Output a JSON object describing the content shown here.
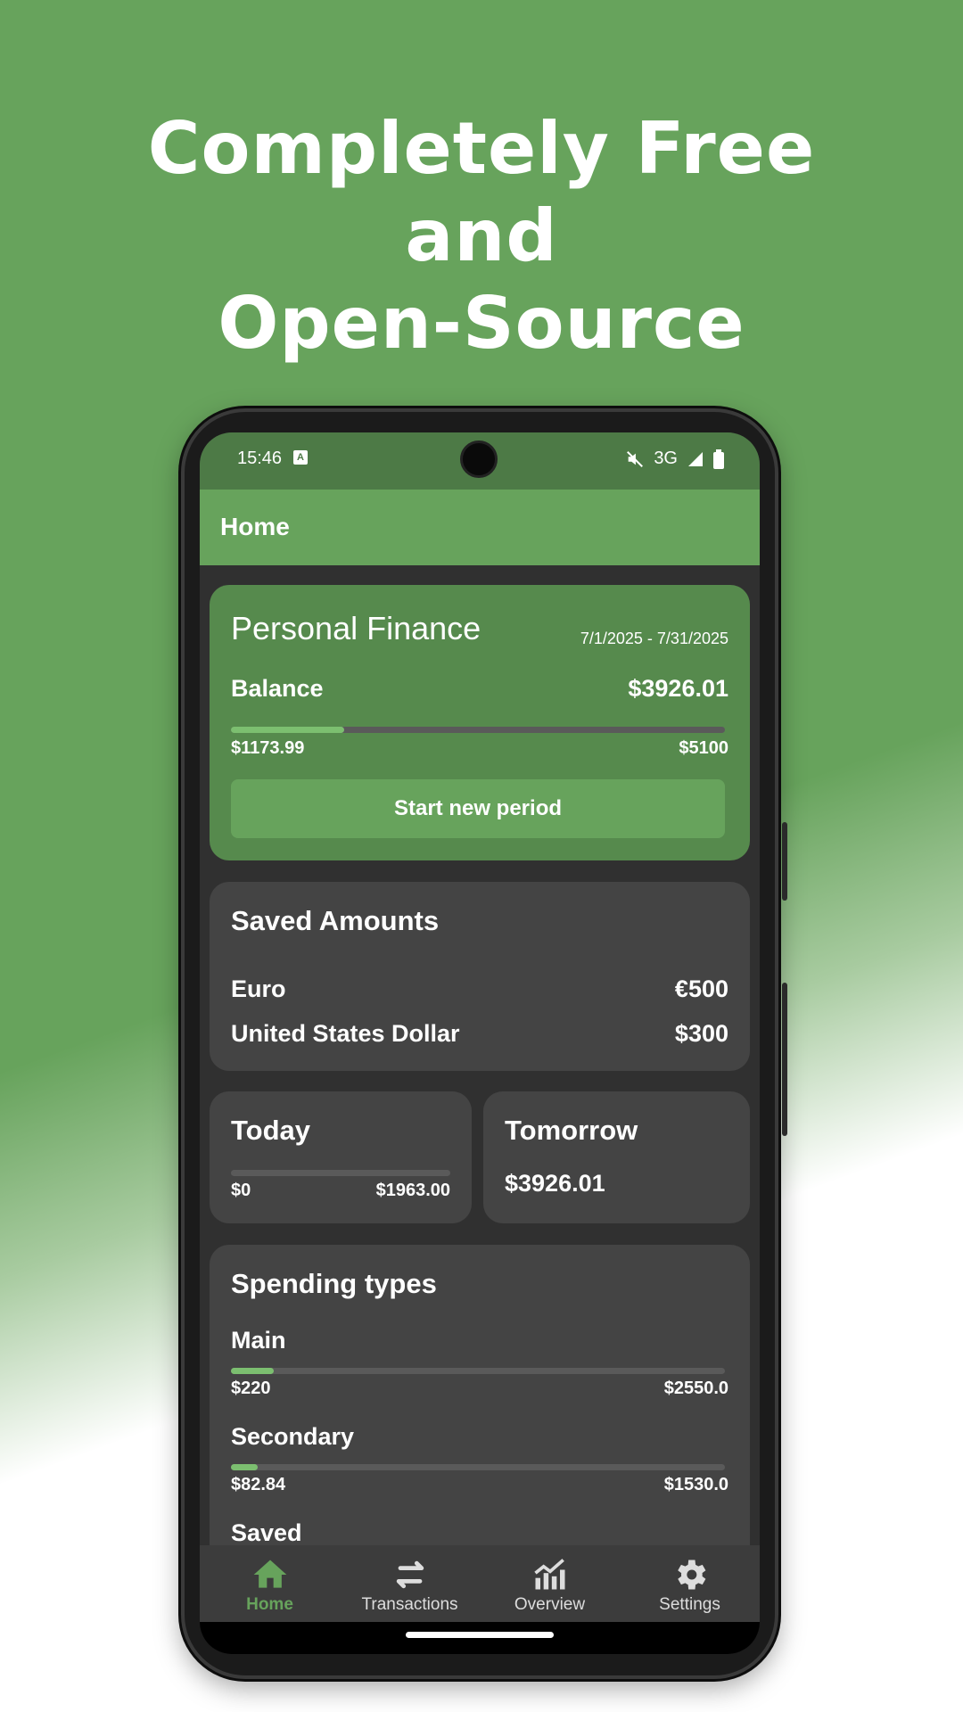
{
  "hero": {
    "line1": "Completely Free",
    "line2": "and",
    "line3": "Open-Source"
  },
  "status_bar": {
    "time": "15:46",
    "network": "3G"
  },
  "app_bar": {
    "title": "Home"
  },
  "finance_card": {
    "title": "Personal Finance",
    "period": "7/1/2025 - 7/31/2025",
    "balance_label": "Balance",
    "balance_value": "$3926.01",
    "spent": "$1173.99",
    "budget": "$5100",
    "progress_fraction": 0.23,
    "button_label": "Start new period"
  },
  "saved_card": {
    "title": "Saved Amounts",
    "items": [
      {
        "label": "Euro",
        "value": "€500"
      },
      {
        "label": "United States Dollar",
        "value": "$300"
      }
    ]
  },
  "today_card": {
    "title": "Today",
    "min": "$0",
    "max": "$1963.00",
    "progress_fraction": 0.0
  },
  "tomorrow_card": {
    "title": "Tomorrow",
    "value": "$3926.01"
  },
  "spending_card": {
    "title": "Spending types",
    "types": [
      {
        "name": "Main",
        "spent": "$220",
        "limit": "$2550.0",
        "progress_fraction": 0.086
      },
      {
        "name": "Secondary",
        "spent": "$82.84",
        "limit": "$1530.0",
        "progress_fraction": 0.054
      },
      {
        "name": "Saved"
      }
    ]
  },
  "nav": {
    "items": [
      {
        "label": "Home",
        "icon": "home-icon"
      },
      {
        "label": "Transactions",
        "icon": "transactions-icon"
      },
      {
        "label": "Overview",
        "icon": "chart-icon"
      },
      {
        "label": "Settings",
        "icon": "gear-icon"
      }
    ]
  },
  "colors": {
    "accent": "#67a35c",
    "card": "#444444",
    "background": "#303030"
  }
}
